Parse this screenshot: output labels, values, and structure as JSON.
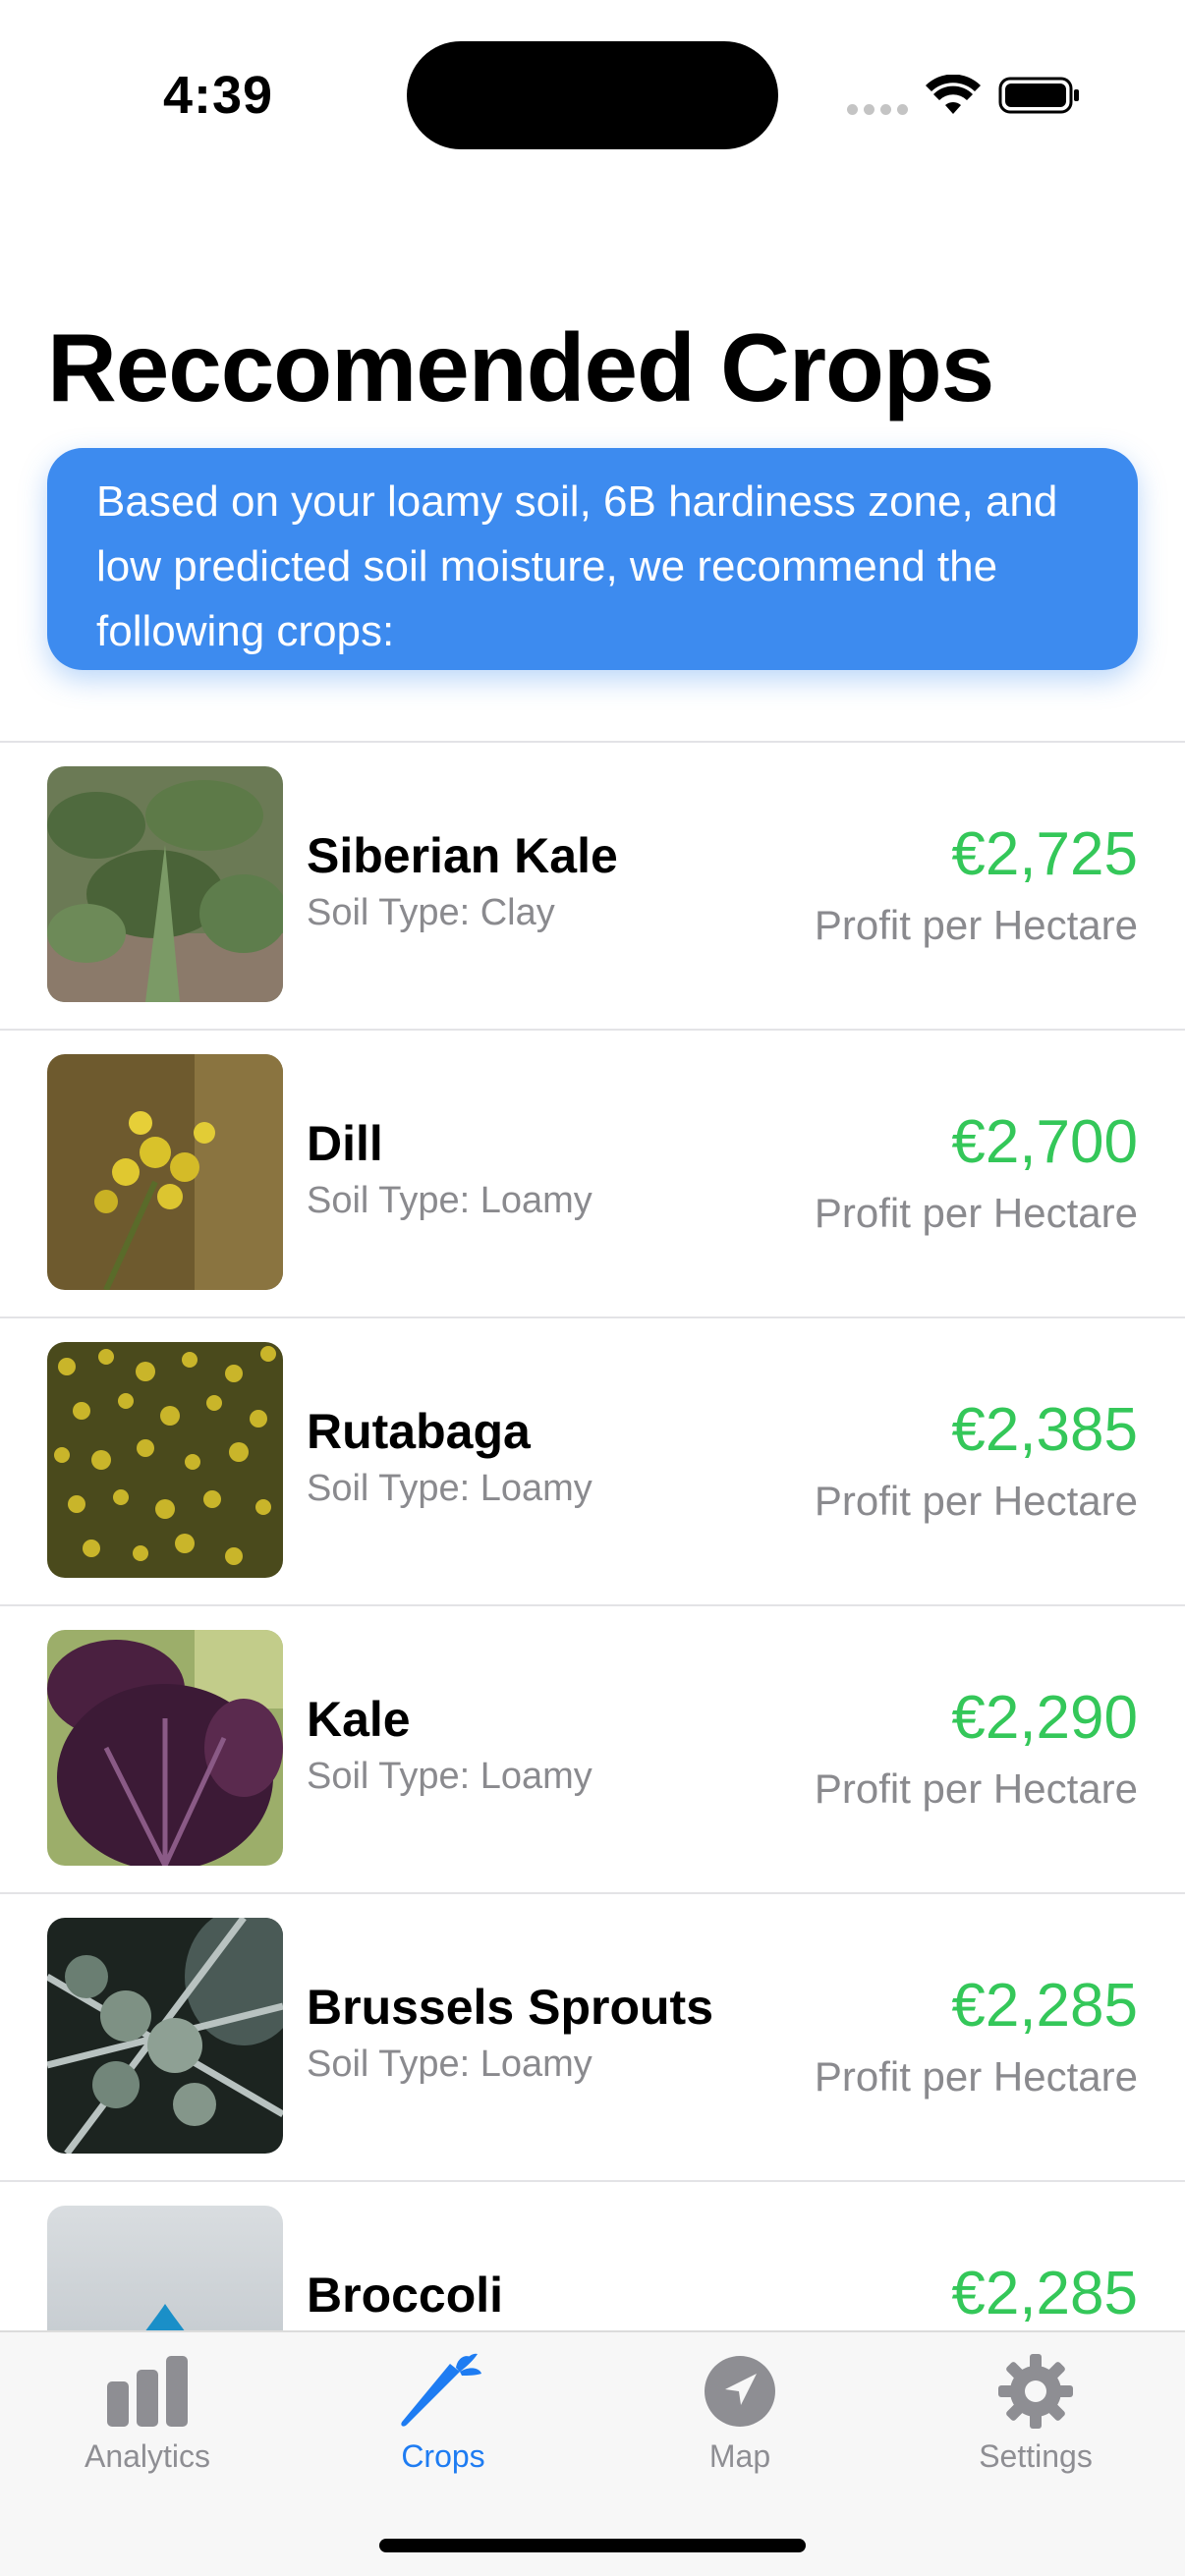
{
  "status_bar": {
    "time": "4:39"
  },
  "page": {
    "title": "Reccomended Crops"
  },
  "banner": {
    "text": "Based on your loamy soil, 6B hardiness zone, and low predicted soil moisture, we recommend the following crops:"
  },
  "crops": [
    {
      "name": "Siberian Kale",
      "soil": "Soil Type: Clay",
      "price": "€2,725",
      "price_label": "Profit per Hectare",
      "image": "kale-field-photo"
    },
    {
      "name": "Dill",
      "soil": "Soil Type: Loamy",
      "price": "€2,700",
      "price_label": "Profit per Hectare",
      "image": "dill-flower-photo"
    },
    {
      "name": "Rutabaga",
      "soil": "Soil Type: Loamy",
      "price": "€2,385",
      "price_label": "Profit per Hectare",
      "image": "rutabaga-flower-photo"
    },
    {
      "name": "Kale",
      "soil": "Soil Type: Loamy",
      "price": "€2,290",
      "price_label": "Profit per Hectare",
      "image": "purple-kale-photo"
    },
    {
      "name": "Brussels Sprouts",
      "soil": "Soil Type: Loamy",
      "price": "€2,285",
      "price_label": "Profit per Hectare",
      "image": "brussels-sprouts-photo"
    },
    {
      "name": "Broccoli",
      "soil": "",
      "price": "€2,285",
      "price_label": "",
      "image": "water-drop-leaf-icon"
    }
  ],
  "tabs": [
    {
      "label": "Analytics",
      "icon": "bar-chart-icon",
      "active": false
    },
    {
      "label": "Crops",
      "icon": "carrot-icon",
      "active": true
    },
    {
      "label": "Map",
      "icon": "location-arrow-icon",
      "active": false
    },
    {
      "label": "Settings",
      "icon": "gear-icon",
      "active": false
    }
  ],
  "colors": {
    "accent": "#1e7cf2",
    "banner": "#3d8bef",
    "price": "#34c759",
    "secondary_text": "#8a8a8e"
  }
}
